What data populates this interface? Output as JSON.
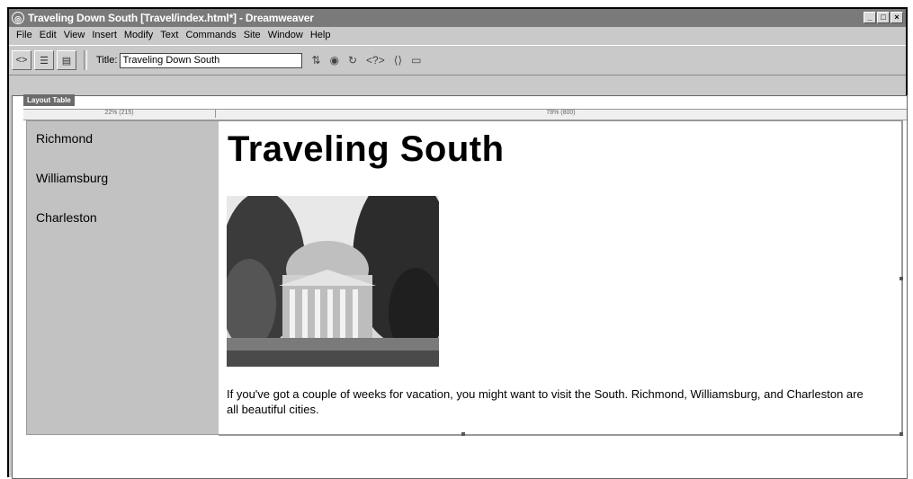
{
  "window": {
    "title": "Traveling Down South [Travel/index.html*] - Dreamweaver",
    "buttons": [
      "_",
      "□",
      "×"
    ]
  },
  "menu": {
    "items": [
      "File",
      "Edit",
      "View",
      "Insert",
      "Modify",
      "Text",
      "Commands",
      "Site",
      "Window",
      "Help"
    ]
  },
  "toolbar": {
    "title_label": "Title:",
    "title_value": "Traveling Down South"
  },
  "layout": {
    "tab_label": "Layout Table",
    "left_col_width": "22%  (215)",
    "right_col_width": "78%  (800)"
  },
  "nav": {
    "links": [
      "Richmond",
      "Williamsburg",
      "Charleston"
    ]
  },
  "main": {
    "heading": "Traveling South",
    "body": "If you've got a couple of weeks for vacation, you might want to visit the South. Richmond, Williamsburg, and Charleston are all beautiful cities."
  }
}
